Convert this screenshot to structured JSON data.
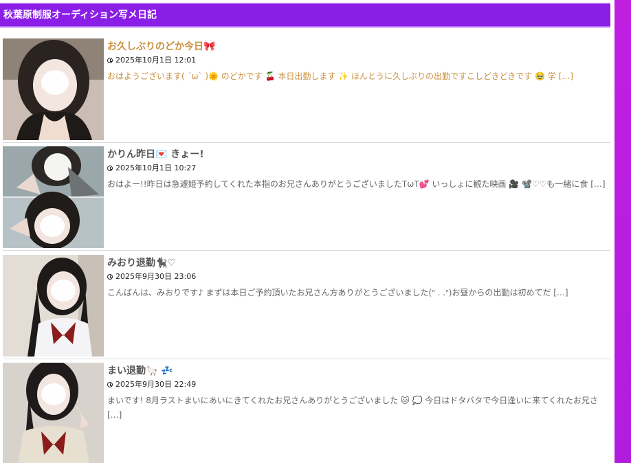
{
  "header": {
    "title": "秋葉原制服オーディション写メ日記"
  },
  "posts": [
    {
      "title": "お久しぶりのどか今日🎀",
      "date": "2025年10月1日 12:01",
      "excerpt": "おはようございます( ´ω` )🌞 のどかです 🍒 本日出勤します ✨ ほんとうに久しぶりの出勤ですこしどきどきです 🥹 学 […]"
    },
    {
      "title": "かりん昨日💌 きょー!",
      "date": "2025年10月1日 10:27",
      "excerpt": "おはよー!!昨日は急遽姫予約してくれた本指のお兄さんありがとうございましたTωT💕 いっしょに観た映画 🎥 📽️♡♡も一緒に食 […]"
    },
    {
      "title": "みおり退勤🐈‍⬛♡",
      "date": "2025年9月30日 23:06",
      "excerpt": "こんばんは、みおりです♪ まずは本日ご予約頂いたお兄さん方ありがとうございました(ᐢ . .ᐢ)お昼からの出勤は初めてだ […]"
    },
    {
      "title": "まい退勤🦙 💤",
      "date": "2025年9月30日 22:49",
      "excerpt": "まいです! 8月ラストまいにあいにきてくれたお兄さんありがとうございました 🐱 💭 今日はドタバタで今日逢いに来てくれたお兄さ […]"
    }
  ],
  "colors": {
    "header_bg": "#8a1ee6",
    "accent_text": "#c9903f",
    "right_bar": "#c01fe0"
  },
  "icons": [
    "clock-icon",
    "photo-thumbnail"
  ]
}
